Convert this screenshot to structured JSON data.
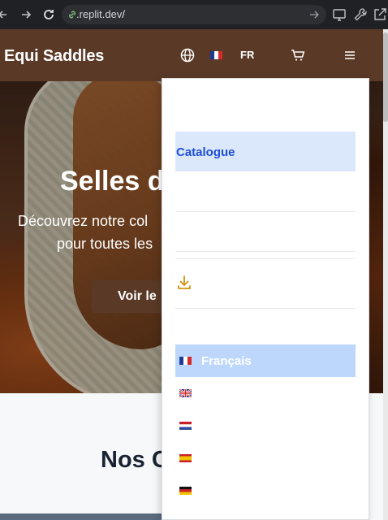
{
  "browser": {
    "url_domain": ".replit.dev",
    "url_path": "/",
    "icons": [
      "back-icon",
      "forward-icon",
      "reload-icon",
      "link-icon",
      "go-arrow-icon",
      "cast-icon",
      "wrench-icon",
      "external-link-icon"
    ]
  },
  "header": {
    "brand": "Equi Saddles",
    "lang_code": "FR",
    "icons": [
      "globe-icon",
      "flag-fr-icon",
      "cart-icon",
      "hamburger-icon"
    ],
    "bg_color": "#5a3a27"
  },
  "hero": {
    "title": "Selles d",
    "subtitle_line1": "Découvrez notre col",
    "subtitle_line2": "pour toutes les",
    "cta_label": "Voir le"
  },
  "section": {
    "title": "Nos C"
  },
  "menu": {
    "catalogue_label": "Catalogue",
    "download_icon": "download-icon",
    "languages": [
      {
        "flag": "fr",
        "label": "Français",
        "active": true
      },
      {
        "flag": "gb",
        "label": "",
        "active": false
      },
      {
        "flag": "nl",
        "label": "",
        "active": false
      },
      {
        "flag": "es",
        "label": "",
        "active": false
      },
      {
        "flag": "de",
        "label": "",
        "active": false
      }
    ],
    "accent_color": "#1d4ed8",
    "active_bg": "#bcd7fb"
  }
}
